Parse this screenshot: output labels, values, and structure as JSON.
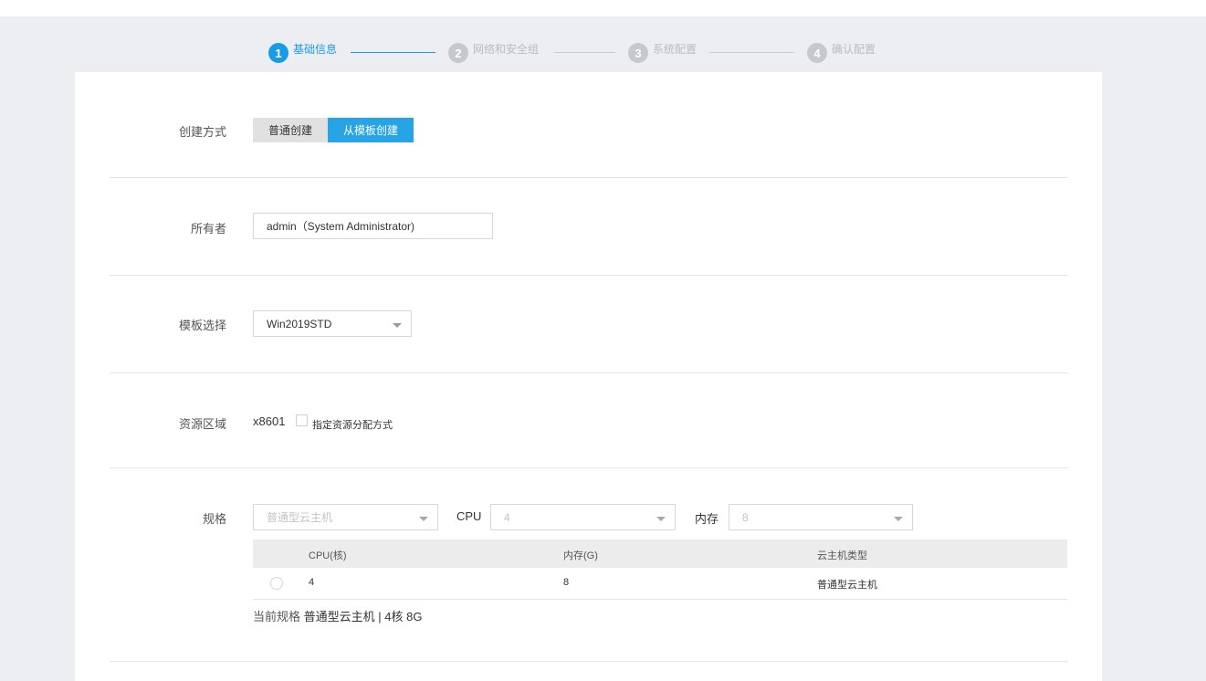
{
  "stepper": {
    "steps": [
      {
        "num": "1",
        "label": "基础信息"
      },
      {
        "num": "2",
        "label": "网络和安全组"
      },
      {
        "num": "3",
        "label": "系统配置"
      },
      {
        "num": "4",
        "label": "确认配置"
      }
    ]
  },
  "form": {
    "create_method": {
      "label": "创建方式",
      "options": [
        "普通创建",
        "从模板创建"
      ],
      "selected": "从模板创建"
    },
    "owner": {
      "label": "所有者",
      "value": "admin（System Administrator)"
    },
    "template": {
      "label": "模板选择",
      "value": "Win2019STD"
    },
    "zone": {
      "label": "资源区域",
      "value": "x8601",
      "checkbox_label": "指定资源分配方式",
      "checked": false
    },
    "spec": {
      "label": "规格",
      "type_value": "普通型云主机",
      "cpu_label": "CPU",
      "cpu_value": "4",
      "mem_label": "内存",
      "mem_value": "8",
      "table": {
        "columns": [
          "CPU(核)",
          "内存(G)",
          "云主机类型"
        ],
        "rows": [
          {
            "cpu": "4",
            "mem": "8",
            "type": "普通型云主机"
          }
        ]
      },
      "current_label": "当前规格",
      "current_value": "普通型云主机 | 4核 8G"
    }
  },
  "colors": {
    "accent": "#1a9be6",
    "button_active": "#27a4e6",
    "background": "#eceef2"
  }
}
